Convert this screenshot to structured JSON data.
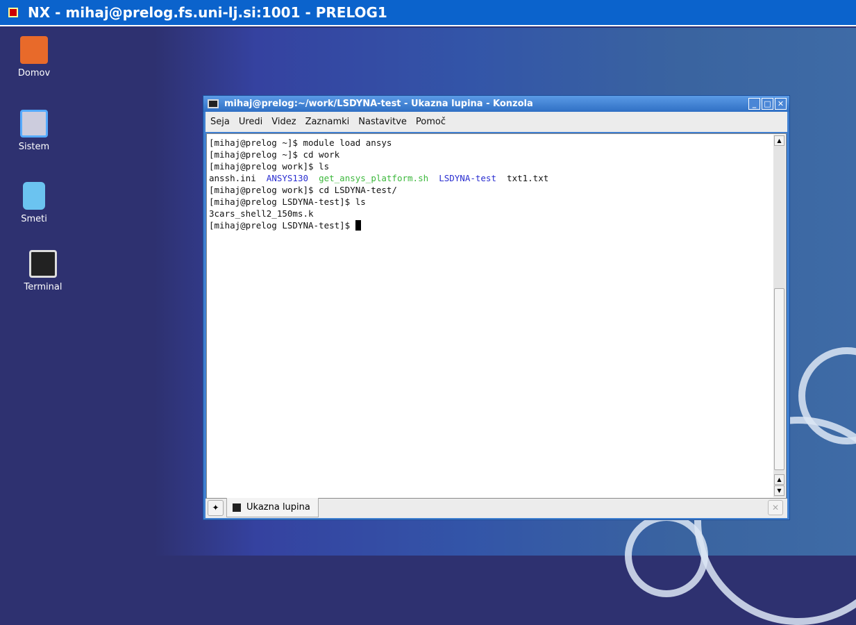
{
  "nx": {
    "title": "NX - mihaj@prelog.fs.uni-lj.si:1001 - PRELOG1"
  },
  "desktop": {
    "icons": [
      {
        "label": "Domov"
      },
      {
        "label": "Sistem"
      },
      {
        "label": "Smeti"
      },
      {
        "label": "Terminal"
      }
    ]
  },
  "window": {
    "title": "mihaj@prelog:~/work/LSDYNA-test - Ukazna lupina - Konzola",
    "menu": [
      "Seja",
      "Uredi",
      "Videz",
      "Zaznamki",
      "Nastavitve",
      "Pomoč"
    ],
    "terminal": {
      "l0": "[mihaj@prelog ~]$ module load ansys",
      "l1": "[mihaj@prelog ~]$ cd work",
      "l2": "[mihaj@prelog work]$ ls",
      "ls": [
        "anssh.ini",
        "ANSYS130",
        "get_ansys_platform.sh",
        "LSDYNA-test",
        "txt1.txt"
      ],
      "l4": "[mihaj@prelog work]$ cd LSDYNA-test/",
      "l5": "[mihaj@prelog LSDYNA-test]$ ls",
      "l6": "3cars_shell2_150ms.k",
      "l7": "[mihaj@prelog LSDYNA-test]$ "
    },
    "tab": "Ukazna lupina"
  },
  "colors": {
    "dir": "#2a2ed0",
    "exec": "#3cb83c"
  }
}
